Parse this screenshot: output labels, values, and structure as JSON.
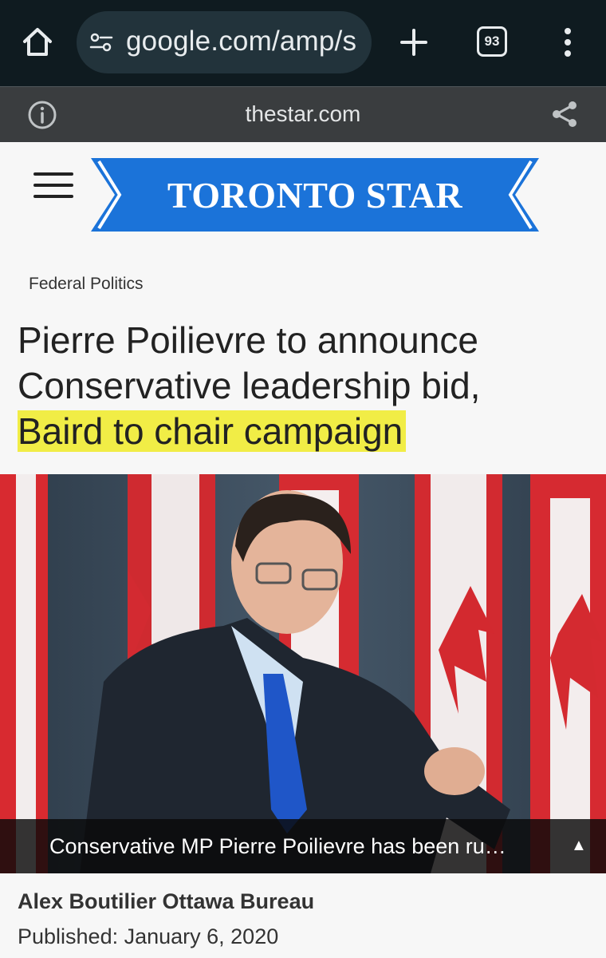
{
  "browser": {
    "url": "google.com/amp/s",
    "tab_count": "93"
  },
  "site_bar": {
    "domain": "thestar.com"
  },
  "header": {
    "logo_text": "TORONTO STAR",
    "brand_color": "#1b73d9"
  },
  "article": {
    "section": "Federal Politics",
    "headline_line1": "Pierre Poilievre to announce",
    "headline_line2": "Conservative leadership bid,",
    "headline_highlight": "Baird to chair campaign",
    "highlight_color": "#f1ed46",
    "image_caption": "Conservative MP Pierre Poilievre has been ru…",
    "caption_toggle": "▲",
    "byline": "Alex Boutilier Ottawa Bureau",
    "published": "Published: January 6, 2020"
  },
  "icons": {
    "home": "home-icon",
    "site_settings": "tune-icon",
    "new_tab": "plus-icon",
    "menu": "more-vert-icon",
    "info": "info-icon",
    "share": "share-icon",
    "nav": "hamburger-icon"
  }
}
